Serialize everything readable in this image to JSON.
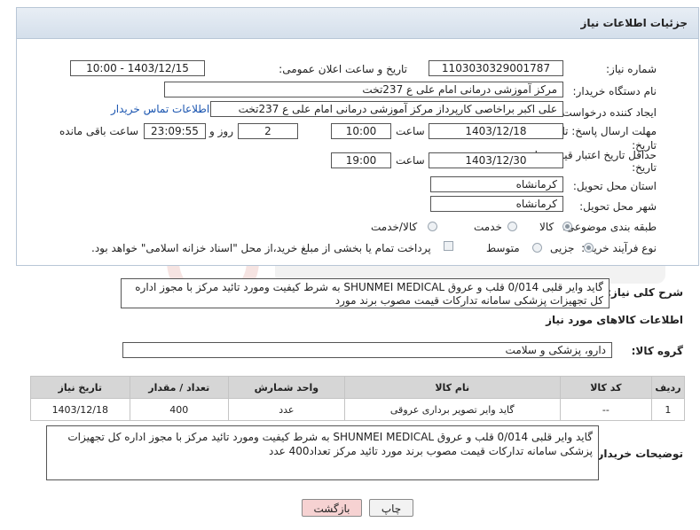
{
  "panel": {
    "title": "جزئیات اطلاعات نیاز"
  },
  "fields": {
    "need_number_label": "شماره نیاز:",
    "need_number": "1103030329001787",
    "announce_label": "تاریخ و ساعت اعلان عمومی:",
    "announce_value": "1403/12/15 - 10:00",
    "buyer_org_label": "نام دستگاه خریدار:",
    "buyer_org": "مرکز آموزشی درمانی امام علی ع 237تخت",
    "requester_label": "ایجاد کننده درخواست:",
    "requester": "علی اکبر براخاصی کارپرداز  مرکز آموزشی درمانی امام علی ع 237تخت",
    "buyer_contact_link": "اطلاعات تماس خریدار",
    "deadline_label_1": "مهلت ارسال پاسخ: تا",
    "deadline_label_2": "تاریخ:",
    "deadline_date": "1403/12/18",
    "time_label": "ساعت",
    "deadline_time": "10:00",
    "days_value": "2",
    "days_label": "روز و",
    "remaining_time": "23:09:55",
    "remaining_label": "ساعت باقی مانده",
    "price_valid_label_1": "حداقل تاریخ اعتبار قیمت: تا",
    "price_valid_label_2": "تاریخ:",
    "price_valid_date": "1403/12/30",
    "price_valid_time": "19:00",
    "province_label": "استان محل تحویل:",
    "province": "کرمانشاه",
    "city_label": "شهر محل تحویل:",
    "city": "کرمانشاه",
    "category_label": "طبقه بندی موضوعی:",
    "category_options": [
      "کالا",
      "خدمت",
      "کالا/خدمت"
    ],
    "process_label": "نوع فرآیند خرید :",
    "process_options": [
      "جزیی",
      "متوسط"
    ],
    "payment_note": "پرداخت تمام یا بخشی از مبلغ خرید،از محل \"اسناد خزانه اسلامی\" خواهد بود."
  },
  "summary": {
    "label": "شرح کلی نیاز:",
    "text": "گاید وایر قلبی 0/014  قلب و عروق  SHUNMEI MEDICAL به شرط کیفیت ومورد تائید مرکز با مجوز اداره کل  تجهیزات پزشکی سامانه تدارکات قیمت مصوب برند مورد"
  },
  "goods_section_title": "اطلاعات کالاهای مورد نیاز",
  "goods_group": {
    "label": "گروه کالا:",
    "value": "دارو، پزشکی و سلامت"
  },
  "table": {
    "headers": [
      "ردیف",
      "کد کالا",
      "نام کالا",
      "واحد شمارش",
      "تعداد / مقدار",
      "تاریخ نیاز"
    ],
    "rows": [
      [
        "1",
        "--",
        "گاید وایر تصویر برداری عروقی",
        "عدد",
        "400",
        "1403/12/18"
      ]
    ]
  },
  "buyer_notes": {
    "label": "توضیحات خریدار:",
    "text": "گاید وایر قلبی 0/014  قلب و عروق  SHUNMEI MEDICAL به شرط کیفیت ومورد تائید مرکز با مجوز اداره کل  تجهیزات پزشکی سامانه تدارکات قیمت مصوب برند مورد تائید مرکز تعداد400 عدد"
  },
  "buttons": {
    "print": "چاپ",
    "back": "بازگشت"
  },
  "colors": {
    "link": "#1a55b0",
    "back_button_bg": "#f6d2d2",
    "header_grad": "#d4dfeb"
  }
}
